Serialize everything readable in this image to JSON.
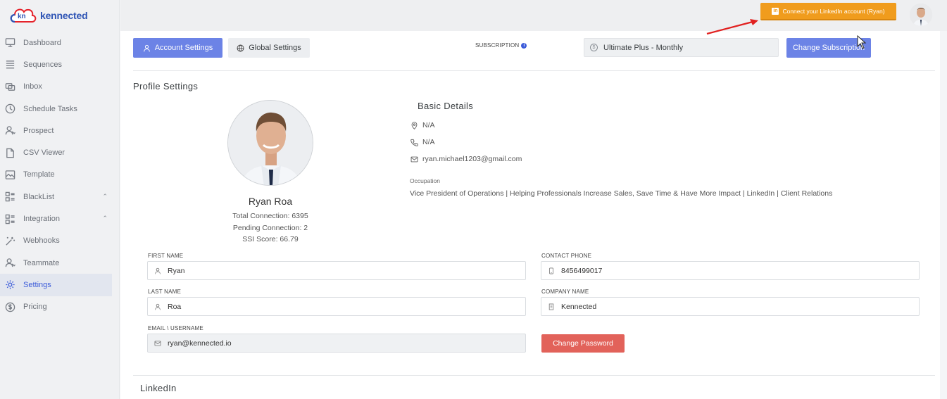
{
  "brand": {
    "logo_mark": "kn",
    "name": "kennected",
    "colors": {
      "primary": "#2f55b5",
      "accent": "#e5232b"
    }
  },
  "sidebar": {
    "items": [
      {
        "label": "Dashboard",
        "icon": "monitor-icon"
      },
      {
        "label": "Sequences",
        "icon": "list-icon"
      },
      {
        "label": "Inbox",
        "icon": "inbox-icon"
      },
      {
        "label": "Schedule Tasks",
        "icon": "clock-icon"
      },
      {
        "label": "Prospect",
        "icon": "users-icon"
      },
      {
        "label": "CSV Viewer",
        "icon": "file-icon"
      },
      {
        "label": "Template",
        "icon": "template-icon"
      },
      {
        "label": "BlackList",
        "icon": "blocks-icon",
        "expandable": true
      },
      {
        "label": "Integration",
        "icon": "blocks-icon",
        "expandable": true
      },
      {
        "label": "Webhooks",
        "icon": "magic-icon"
      },
      {
        "label": "Teammate",
        "icon": "users-icon"
      },
      {
        "label": "Settings",
        "icon": "gear-icon",
        "active": true
      },
      {
        "label": "Pricing",
        "icon": "dollar-icon"
      }
    ]
  },
  "topbar": {
    "linkedin_button": "Connect your LinkedIn account (Ryan)",
    "linkedin_color": "#f09c1d"
  },
  "tabs": {
    "account": "Account Settings",
    "global": "Global Settings"
  },
  "subscription": {
    "label": "SUBSCRIPTION",
    "value": "Ultimate Plus - Monthly",
    "change_button": "Change Subscription"
  },
  "profile": {
    "section_title": "Profile Settings",
    "name": "Ryan Roa",
    "total_connection": "Total Connection: 6395",
    "pending_connection": "Pending Connection: 2",
    "ssi_score": "SSI Score: 66.79"
  },
  "basic_details": {
    "title": "Basic Details",
    "location": "N/A",
    "phone": "N/A",
    "email": "ryan.michael1203@gmail.com",
    "occupation_label": "Occupation",
    "occupation": "Vice President of Operations | Helping Professionals Increase Sales, Save Time & Have More Impact | LinkedIn | Client Relations"
  },
  "form": {
    "first_name_label": "FIRST NAME",
    "first_name": "Ryan",
    "last_name_label": "LAST NAME",
    "last_name": "Roa",
    "email_label": "EMAIL \\ USERNAME",
    "email": "ryan@kennected.io",
    "contact_phone_label": "CONTACT PHONE",
    "contact_phone": "8456499017",
    "company_name_label": "COMPANY NAME",
    "company_name": "Kennected",
    "change_password": "Change Password"
  },
  "linkedin_section": {
    "title": "LinkedIn"
  }
}
